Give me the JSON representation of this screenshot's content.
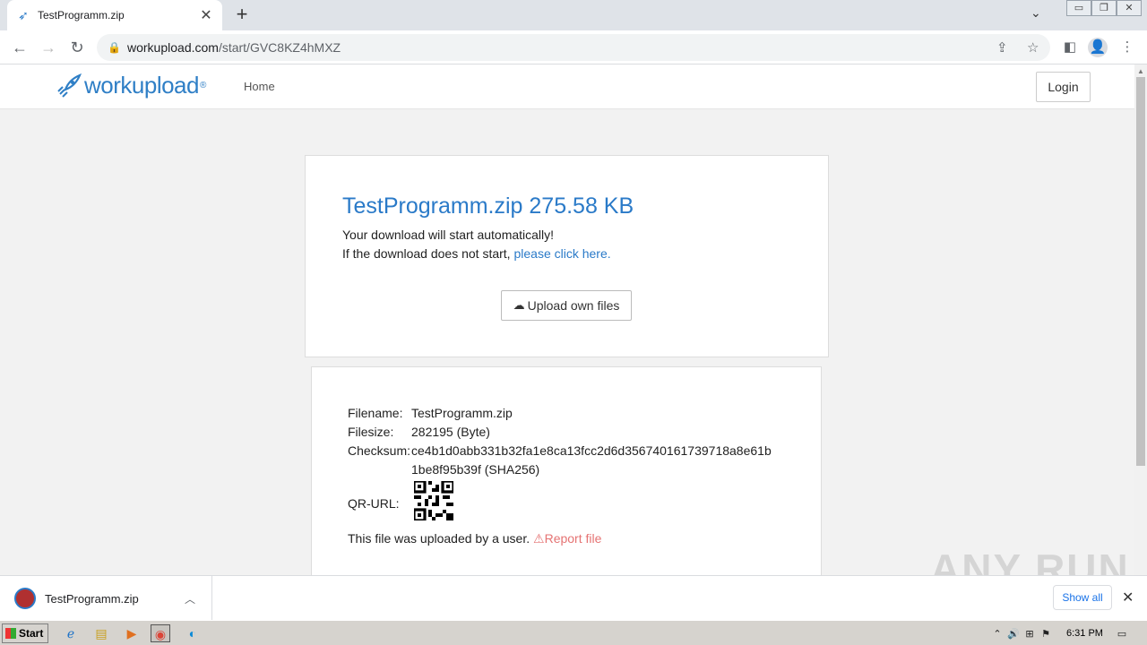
{
  "browser": {
    "tab_title": "TestProgramm.zip",
    "url_host": "workupload.com",
    "url_path": "/start/GVC8KZ4hMXZ"
  },
  "site": {
    "logo_text": "workupload",
    "logo_reg": "®",
    "nav_home": "Home",
    "login_label": "Login"
  },
  "download_card": {
    "file_title": "TestProgramm.zip 275.58 KB",
    "auto_start": "Your download will start automatically!",
    "fallback_prefix": "If the download does not start, ",
    "fallback_link": "please click here.",
    "upload_label": "Upload own files"
  },
  "info_card": {
    "filename_label": "Filename:",
    "filename_value": "TestProgramm.zip",
    "filesize_label": "Filesize:",
    "filesize_value": "282195 (Byte)",
    "checksum_label": "Checksum:",
    "checksum_line1": "ce4b1d0abb331b32fa1e8ca13fcc2d6d356740161739718a8e61b",
    "checksum_line2": "1be8f95b39f (SHA256)",
    "qr_label": "QR-URL:",
    "uploaded_by": "This file was uploaded by a user.",
    "report_label": "Report file"
  },
  "shelf": {
    "download_name": "TestProgramm.zip",
    "show_all": "Show all"
  },
  "watermark": "ANY RUN",
  "taskbar": {
    "start_label": "Start",
    "clock": "6:31 PM"
  }
}
